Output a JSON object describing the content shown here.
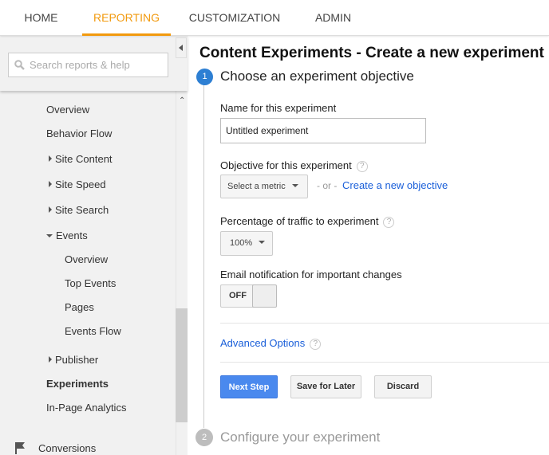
{
  "nav": {
    "tabs": [
      {
        "label": "HOME"
      },
      {
        "label": "REPORTING",
        "active": true
      },
      {
        "label": "CUSTOMIZATION"
      },
      {
        "label": "ADMIN"
      }
    ]
  },
  "sidebar": {
    "search_placeholder": "Search reports & help",
    "items": [
      {
        "label": "Overview"
      },
      {
        "label": "Behavior Flow"
      },
      {
        "label": "Site Content"
      },
      {
        "label": "Site Speed"
      },
      {
        "label": "Site Search"
      },
      {
        "label": "Events"
      },
      {
        "label": "Overview"
      },
      {
        "label": "Top Events"
      },
      {
        "label": "Pages"
      },
      {
        "label": "Events Flow"
      },
      {
        "label": "Publisher"
      },
      {
        "label": "Experiments"
      },
      {
        "label": "In-Page Analytics"
      },
      {
        "label": "Conversions"
      }
    ]
  },
  "main": {
    "title": "Content Experiments - Create a new experiment",
    "step1": {
      "number": "1",
      "title": "Choose an experiment objective"
    },
    "name_label": "Name for this experiment",
    "name_value": "Untitled experiment",
    "objective_label": "Objective for this experiment",
    "objective_select": "Select a metric",
    "or_text": "- or -",
    "create_objective": "Create a new objective",
    "traffic_label": "Percentage of traffic to experiment",
    "traffic_value": "100%",
    "email_label": "Email notification for important changes",
    "email_toggle": "OFF",
    "advanced": "Advanced Options",
    "help": "?",
    "next": "Next Step",
    "save": "Save for Later",
    "discard": "Discard",
    "step2": {
      "number": "2",
      "title": "Configure your experiment"
    }
  },
  "colors": {
    "accent": "#f29a0e",
    "primary": "#4285f4",
    "link": "#1a5fd9"
  }
}
